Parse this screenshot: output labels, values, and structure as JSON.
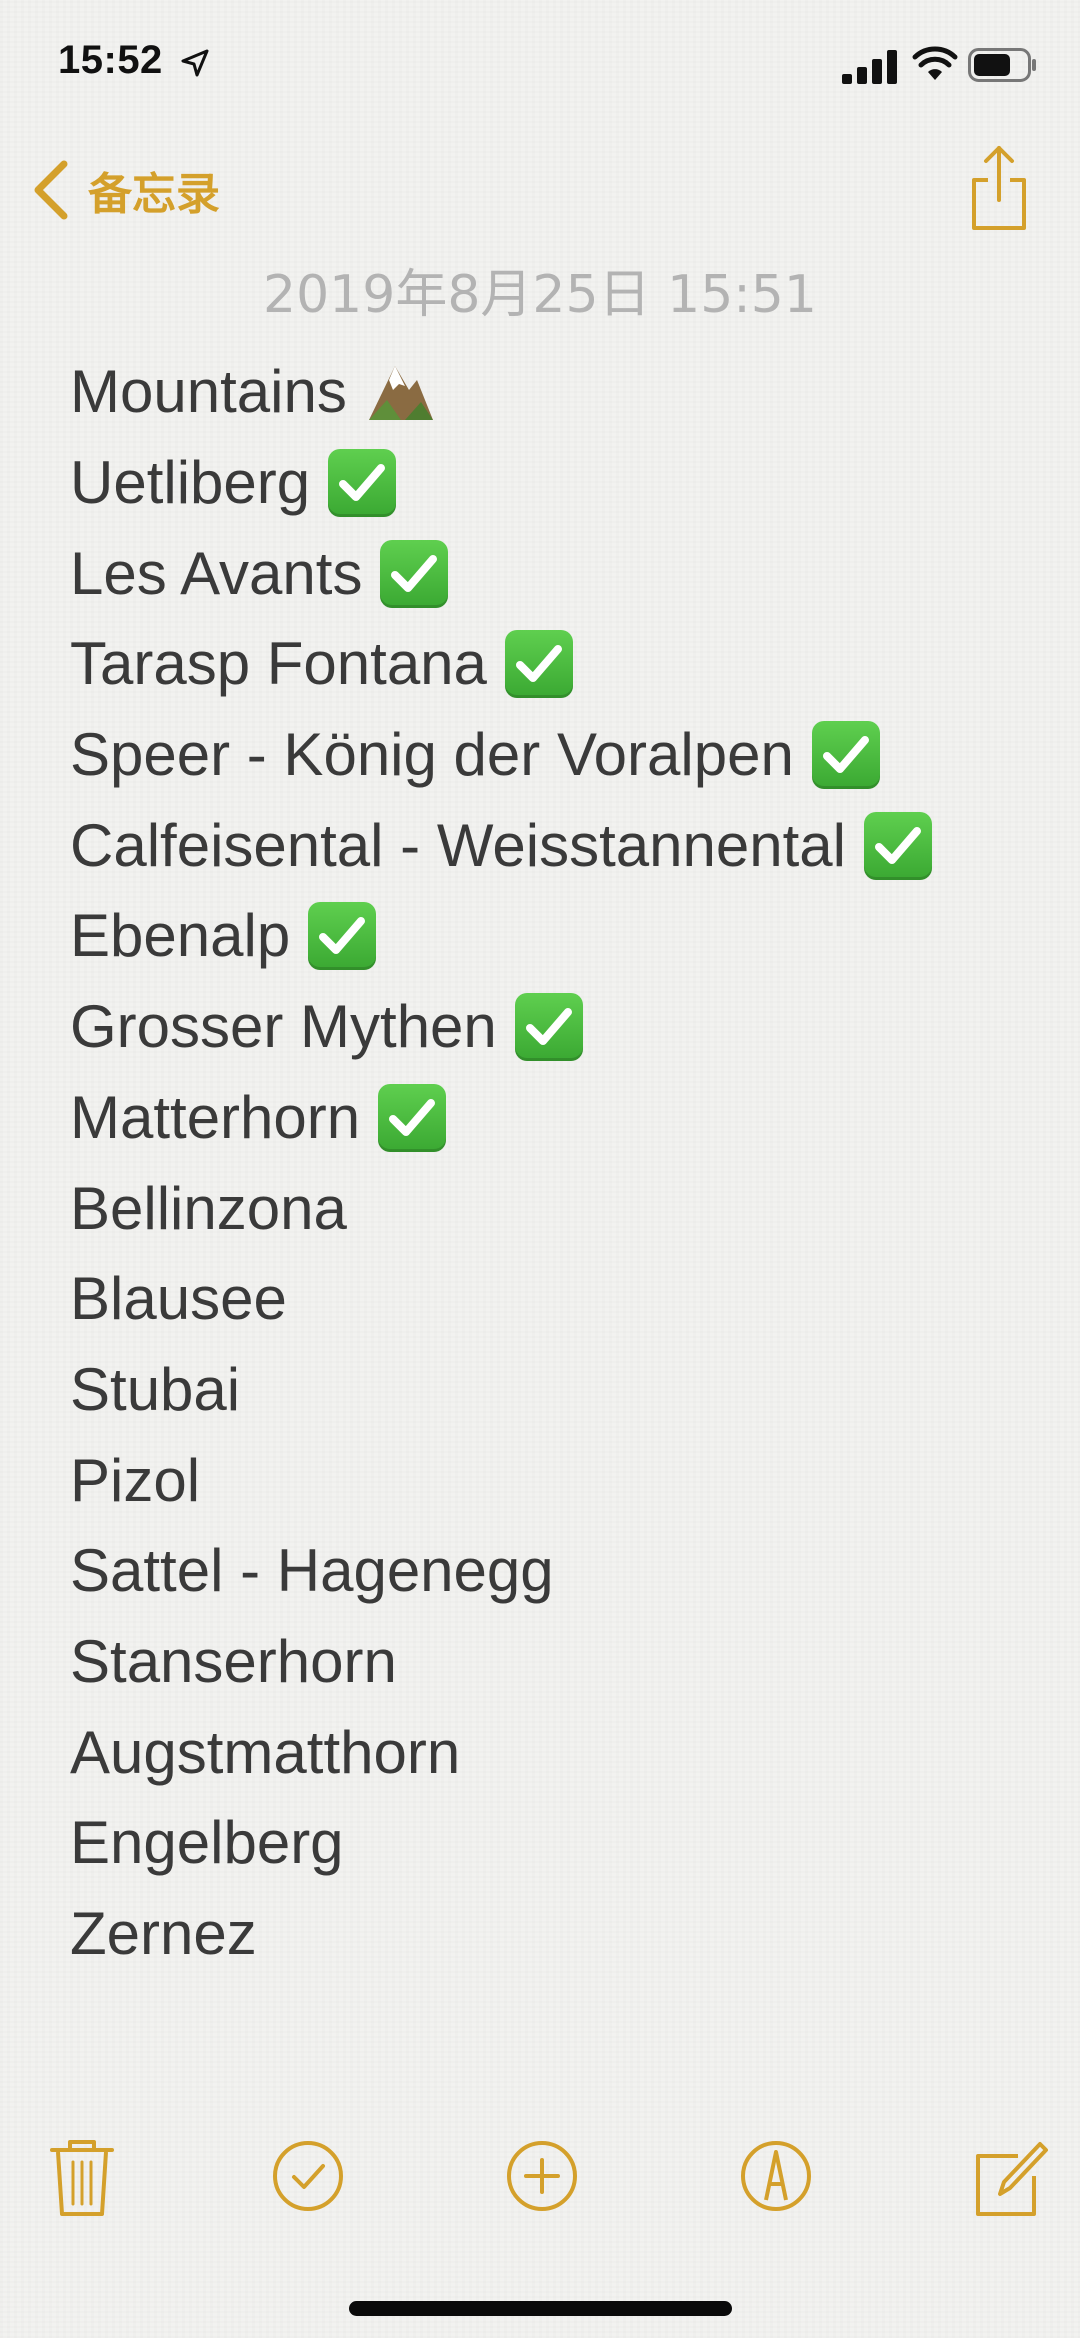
{
  "status_bar": {
    "time": "15:52"
  },
  "nav": {
    "back_label": "备忘录"
  },
  "note": {
    "date": "2019年8月25日 15:51",
    "lines": [
      {
        "text": "Mountains",
        "emoji": "mountain-icon"
      },
      {
        "text": "Uetliberg",
        "emoji": "check-mark-icon"
      },
      {
        "text": "Les Avants",
        "emoji": "check-mark-icon"
      },
      {
        "text": "Tarasp Fontana",
        "emoji": "check-mark-icon"
      },
      {
        "text": "Speer - König der Voralpen",
        "emoji": "check-mark-icon"
      },
      {
        "text": "Calfeisental - Weisstannental",
        "emoji": "check-mark-icon"
      },
      {
        "text": "Ebenalp",
        "emoji": "check-mark-icon"
      },
      {
        "text": "Grosser Mythen",
        "emoji": "check-mark-icon"
      },
      {
        "text": "Matterhorn",
        "emoji": "check-mark-icon"
      },
      {
        "text": "Bellinzona",
        "emoji": ""
      },
      {
        "text": "Blausee",
        "emoji": ""
      },
      {
        "text": "Stubai",
        "emoji": ""
      },
      {
        "text": "Pizol",
        "emoji": ""
      },
      {
        "text": "Sattel - Hagenegg",
        "emoji": ""
      },
      {
        "text": "Stanserhorn",
        "emoji": ""
      },
      {
        "text": "Augstmatthorn",
        "emoji": ""
      },
      {
        "text": "Engelberg",
        "emoji": ""
      },
      {
        "text": "Zernez",
        "emoji": ""
      }
    ]
  },
  "toolbar": {
    "items": [
      "trash-icon",
      "checklist-icon",
      "add-icon",
      "markup-icon",
      "compose-icon"
    ]
  },
  "colors": {
    "accent": "#d4a02b",
    "text": "#3a3a3a",
    "date": "#b3b3b3",
    "background": "#f2f2f0"
  }
}
